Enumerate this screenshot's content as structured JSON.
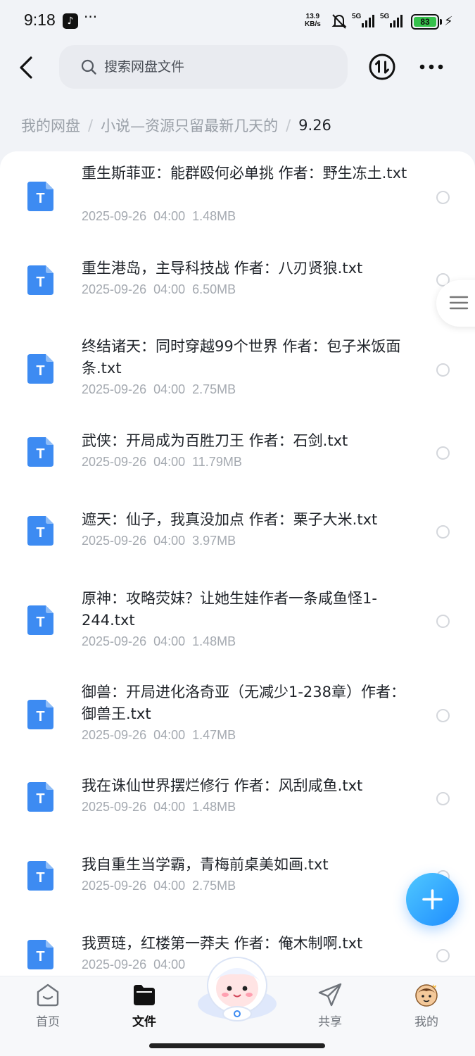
{
  "status_bar": {
    "time": "9:18",
    "app_icon": "tiktok-icon",
    "more": "···",
    "net_speed_value": "13.9",
    "net_speed_unit": "KB/s",
    "signal1": "5G",
    "signal2": "5G",
    "battery": "83"
  },
  "header": {
    "search_placeholder": "搜索网盘文件"
  },
  "breadcrumb": {
    "items": [
      "我的网盘",
      "小说—资源只留最新几天的",
      "9.26"
    ],
    "separator": "/"
  },
  "files": [
    {
      "name": "重生斯菲亚：能群殴何必单挑 作者：野生冻土.txt",
      "date": "2025-09-26",
      "time": "04:00",
      "size": "1.48MB"
    },
    {
      "name": "重生港岛，主导科技战 作者：八刃贤狼.txt",
      "date": "2025-09-26",
      "time": "04:00",
      "size": "6.50MB"
    },
    {
      "name": "终结诸天：同时穿越99个世界 作者：包子米饭面条.txt",
      "date": "2025-09-26",
      "time": "04:00",
      "size": "2.75MB"
    },
    {
      "name": "武侠：开局成为百胜刀王 作者：石剑.txt",
      "date": "2025-09-26",
      "time": "04:00",
      "size": "11.79MB"
    },
    {
      "name": "遮天：仙子，我真没加点 作者：栗子大米.txt",
      "date": "2025-09-26",
      "time": "04:00",
      "size": "3.97MB"
    },
    {
      "name": "原神：攻略荧妹？让她生娃作者一条咸鱼怪1-244.txt",
      "date": "2025-09-26",
      "time": "04:00",
      "size": "1.48MB"
    },
    {
      "name": "御兽：开局进化洛奇亚（无减少1-238章）作者：御兽王.txt",
      "date": "2025-09-26",
      "time": "04:00",
      "size": "1.47MB"
    },
    {
      "name": "我在诛仙世界摆烂修行 作者：风刮咸鱼.txt",
      "date": "2025-09-26",
      "time": "04:00",
      "size": "1.48MB"
    },
    {
      "name": "我自重生当学霸，青梅前桌美如画.txt",
      "date": "2025-09-26",
      "time": "04:00",
      "size": "2.75MB"
    },
    {
      "name": "我贾琏，红楼第一莽夫 作者：俺木制啊.txt",
      "date": "2025-09-26",
      "time": "04:00",
      "size": ""
    }
  ],
  "file_icon_letter": "T",
  "bottom_nav": {
    "items": [
      {
        "label": "首页",
        "icon": "home-icon"
      },
      {
        "label": "文件",
        "icon": "folder-icon",
        "active": true
      },
      {
        "label": "共享",
        "icon": "share-icon"
      },
      {
        "label": "我的",
        "icon": "avatar-icon"
      }
    ]
  },
  "colors": {
    "accent": "#3d8bf2",
    "fab_gradient_start": "#4fc8ff",
    "fab_gradient_end": "#1f8dff",
    "battery": "#35c14b"
  }
}
